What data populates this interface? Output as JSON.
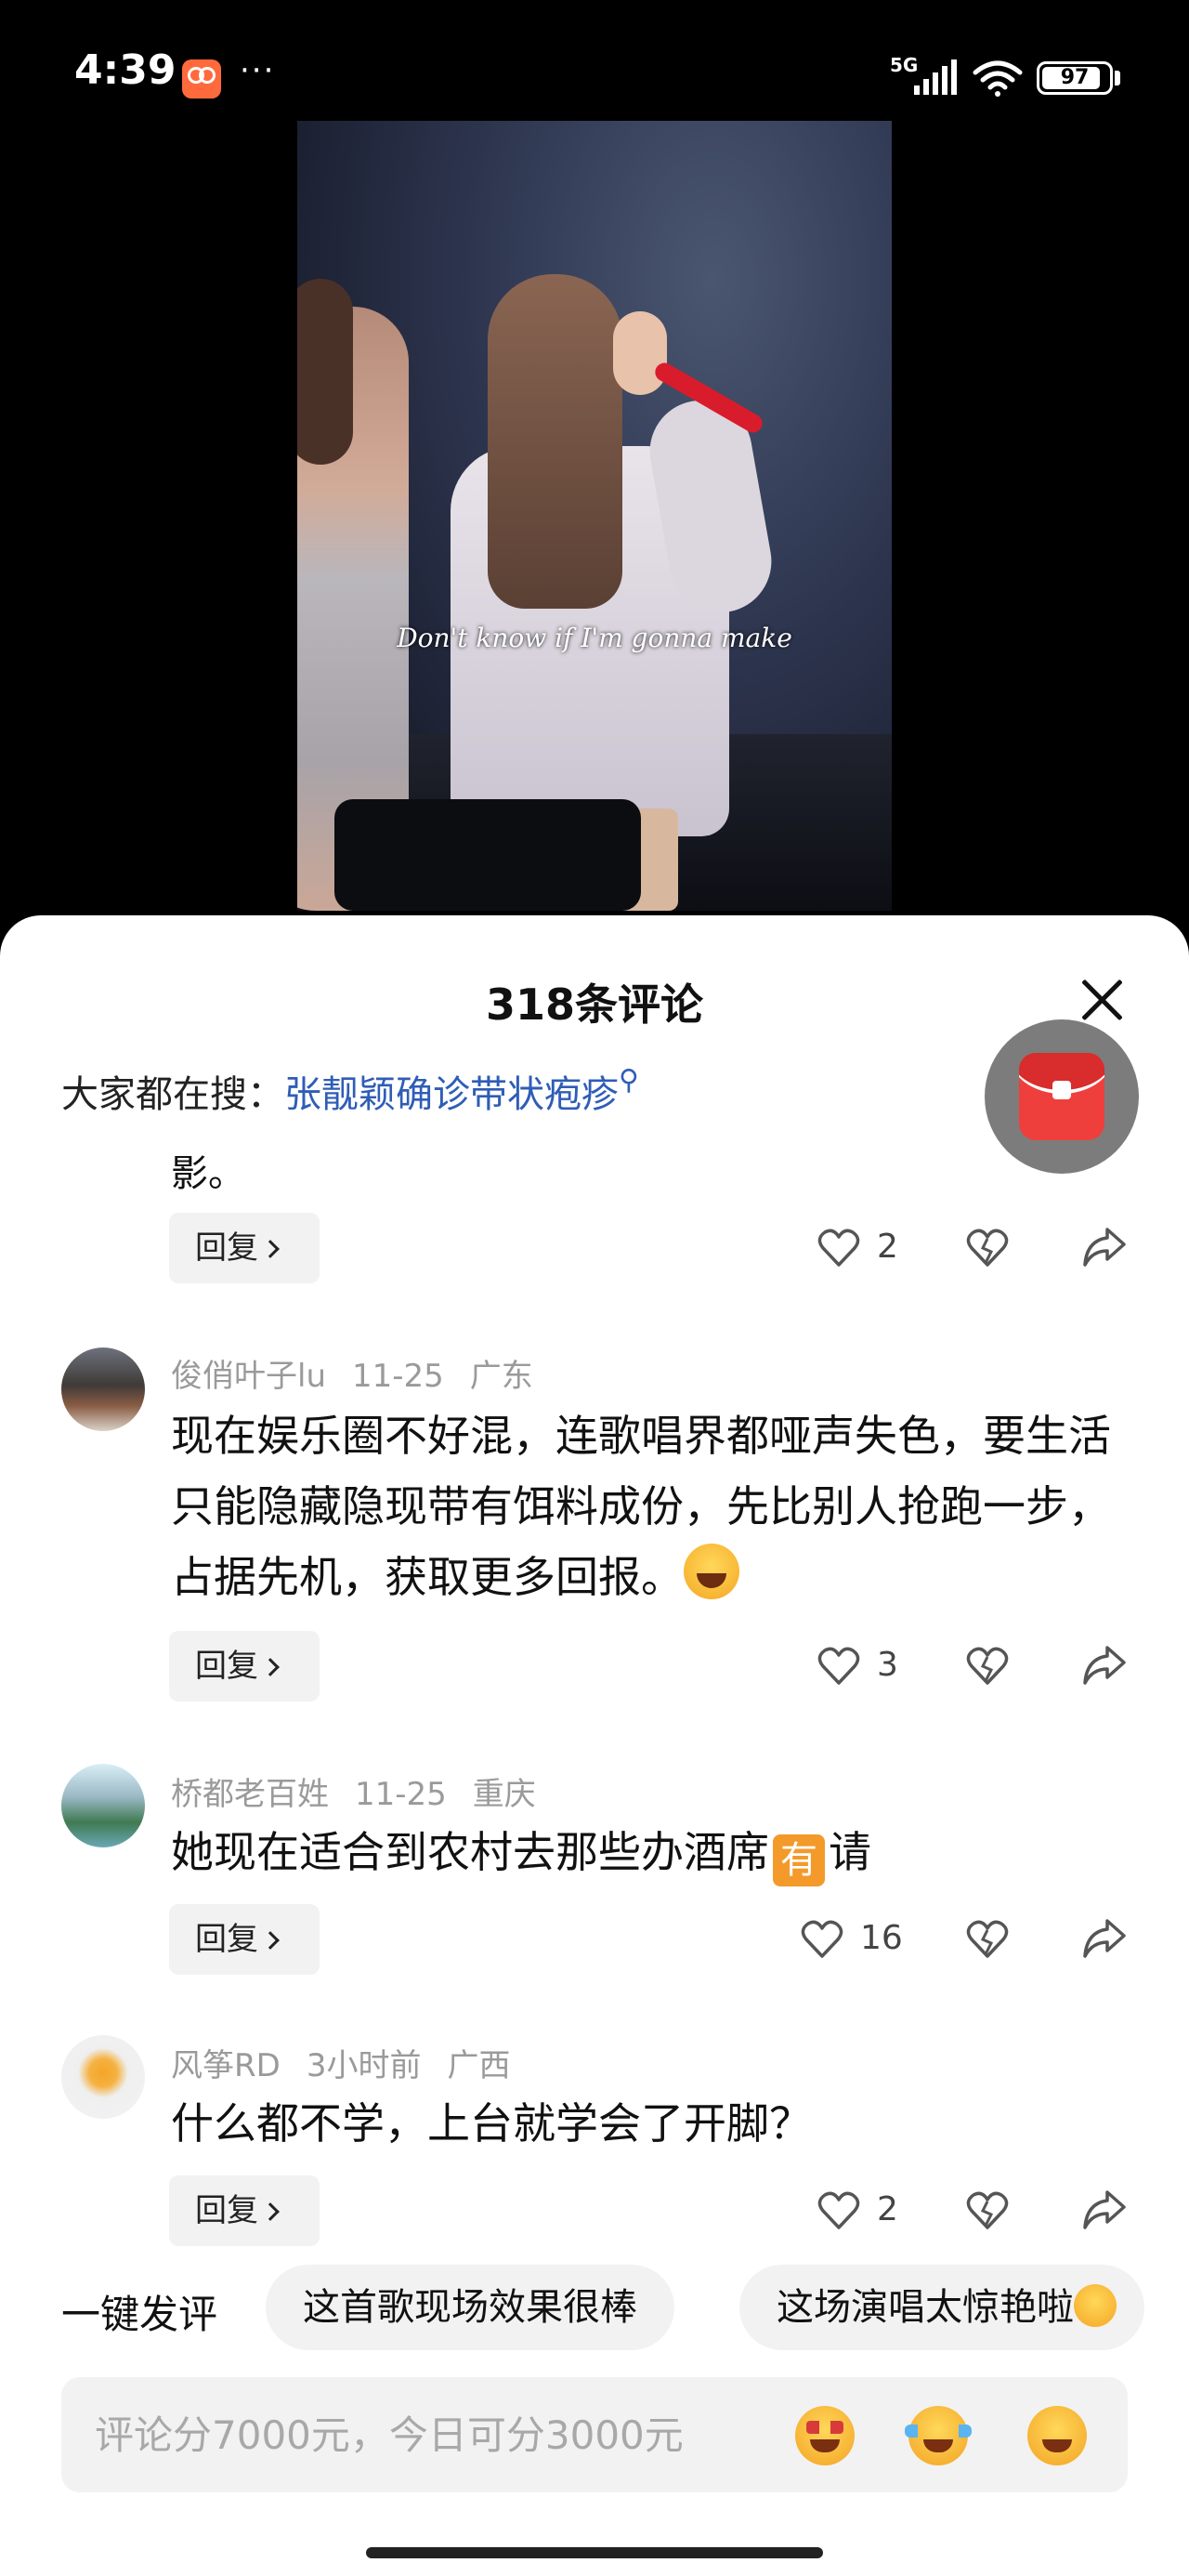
{
  "status_bar": {
    "time": "4:39",
    "network": "5G",
    "battery": "97",
    "more": "···"
  },
  "video": {
    "subtitle": "Don't know if I'm gonna make"
  },
  "sheet": {
    "title": "318条评论",
    "hot_search_label": "大家都在搜：",
    "hot_search_link": "张靓颖确诊带状疱疹",
    "search_glyph": "⚲"
  },
  "comments": {
    "tail_text": "影。",
    "reply_label": "回复",
    "first": {
      "likes": "2"
    },
    "items": [
      {
        "author": "俊俏叶子lu",
        "date": "11-25",
        "region": "广东",
        "text": "现在娱乐圈不好混，连歌唱界都哑声失色，要生活只能隐藏隐现带有饵料成份，先比别人抢跑一步，占据先机，获取更多回报。",
        "likes": "3"
      },
      {
        "author": "桥都老百姓",
        "date": "11-25",
        "region": "重庆",
        "text_before": "她现在适合到农村去那些办酒席",
        "tag": "有",
        "text_after": "请",
        "likes": "16"
      },
      {
        "author": "风筝RD",
        "date": "3小时前",
        "region": "广西",
        "text": "什么都不学，上台就学会了开脚？",
        "likes": "2"
      }
    ]
  },
  "quick_reply": {
    "label": "一键发评",
    "chips": [
      "这首歌现场效果很棒",
      "这场演唱太惊艳啦"
    ]
  },
  "input": {
    "placeholder": "评论分7000元，今日可分3000元"
  },
  "icons": {
    "like": "heart-icon",
    "dislike": "broken-heart-icon",
    "share": "share-icon",
    "close": "close-icon",
    "red_packet": "red-packet-icon"
  }
}
